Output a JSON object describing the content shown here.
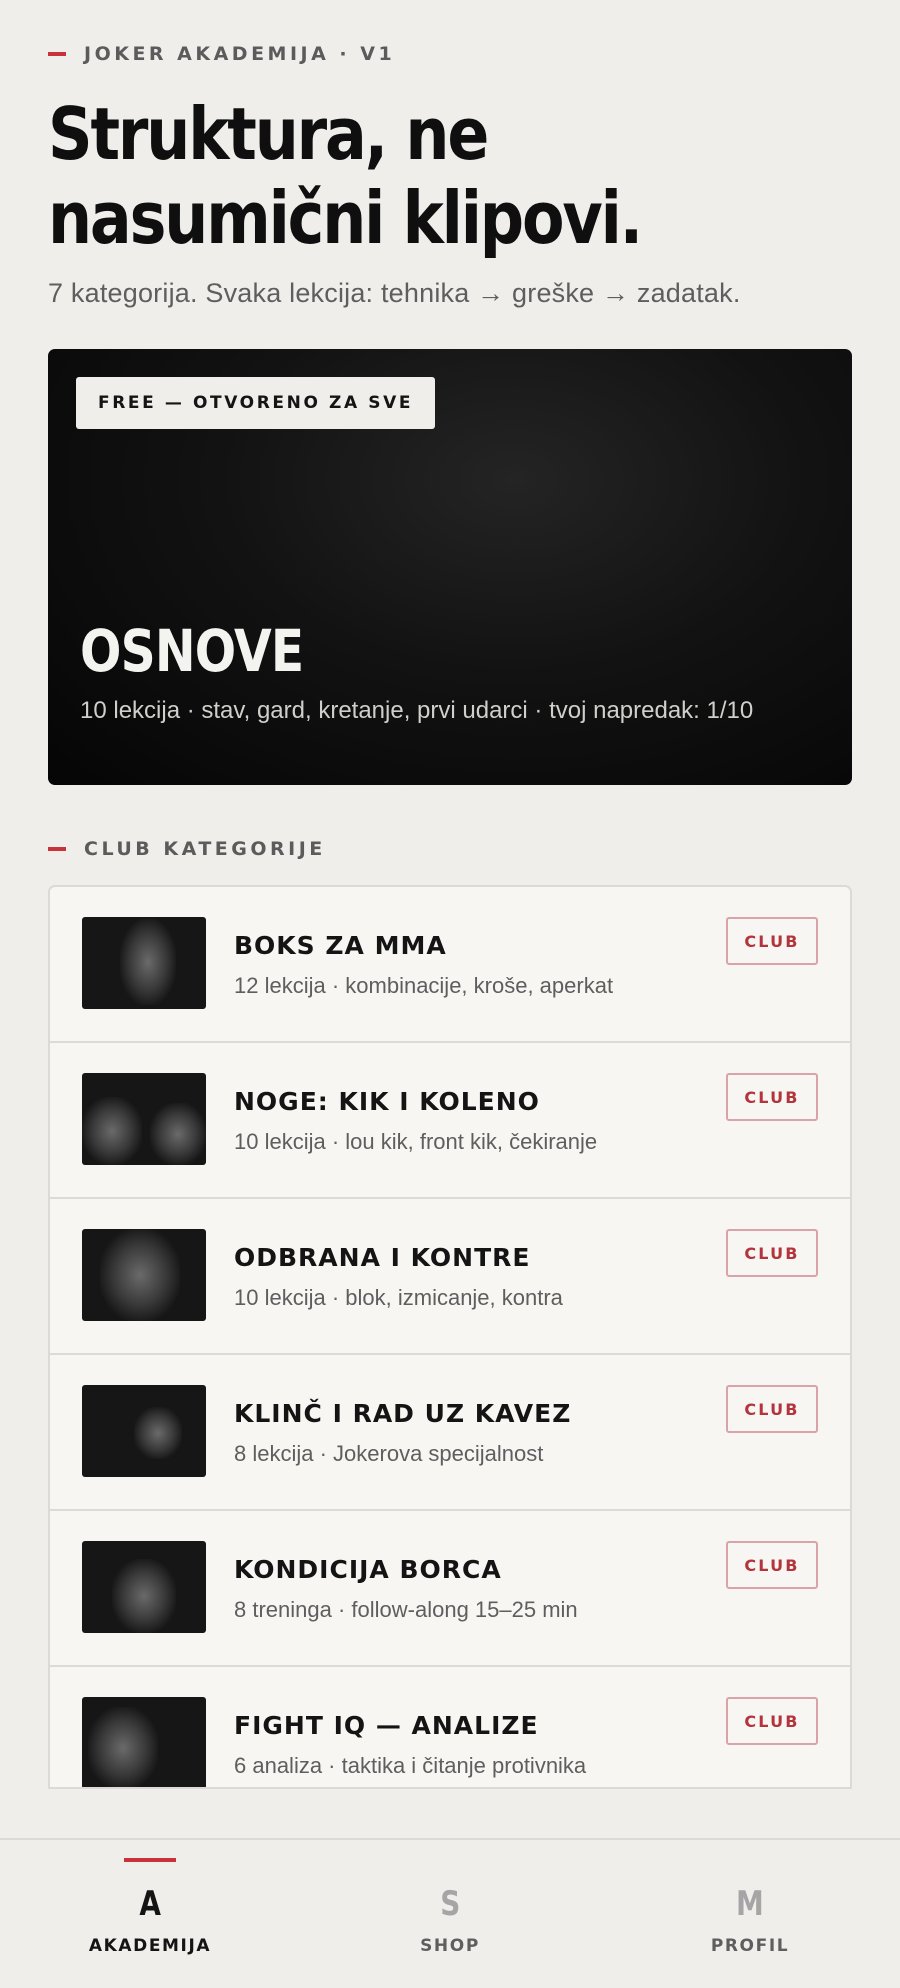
{
  "header": {
    "eyebrow": "JOKER AKADEMIJA · V1",
    "headline": "Struktura, ne nasumični klipovi.",
    "subtitle": "7 kategorija. Svaka lekcija: tehnika → greške → zadatak."
  },
  "featured": {
    "badge": "FREE — OTVORENO ZA SVE",
    "title": "OSNOVE",
    "meta": "10 lekcija · stav, gard, kretanje, prvi udarci · tvoj napredak: 1/10"
  },
  "club_section": {
    "label": "CLUB KATEGORIJE"
  },
  "categories": [
    {
      "title": "BOKS ZA MMA",
      "meta": "12 lekcija · kombinacije, kroše, aperkat",
      "badge": "CLUB",
      "thumbnail_icon": "fighter-photo"
    },
    {
      "title": "NOGE: KIK I KOLENO",
      "meta": "10 lekcija · lou kik, front kik, čekiranje",
      "badge": "CLUB",
      "thumbnail_icon": "fighter-photo"
    },
    {
      "title": "ODBRANA I KONTRE",
      "meta": "10 lekcija · blok, izmicanje, kontra",
      "badge": "CLUB",
      "thumbnail_icon": "fighter-photo"
    },
    {
      "title": "KLINČ I RAD UZ KAVEZ",
      "meta": "8 lekcija · Jokerova specijalnost",
      "badge": "CLUB",
      "thumbnail_icon": "fighter-photo"
    },
    {
      "title": "KONDICIJA BORCA",
      "meta": "8 treninga · follow-along 15–25 min",
      "badge": "CLUB",
      "thumbnail_icon": "fighter-photo"
    },
    {
      "title": "FIGHT IQ — ANALIZE",
      "meta": "6 analiza · taktika i čitanje protivnika",
      "badge": "CLUB",
      "thumbnail_icon": "fighter-photo"
    }
  ],
  "bottom_nav": {
    "items": [
      {
        "glyph": "A",
        "label": "AKADEMIJA",
        "active": true
      },
      {
        "glyph": "S",
        "label": "SHOP",
        "active": false
      },
      {
        "glyph": "M",
        "label": "PROFIL",
        "active": false
      }
    ]
  },
  "colors": {
    "background": "#efeeeb",
    "accent": "#c8323a",
    "card_dark": "#0a0a0a",
    "club_badge_text": "#b3343c"
  }
}
